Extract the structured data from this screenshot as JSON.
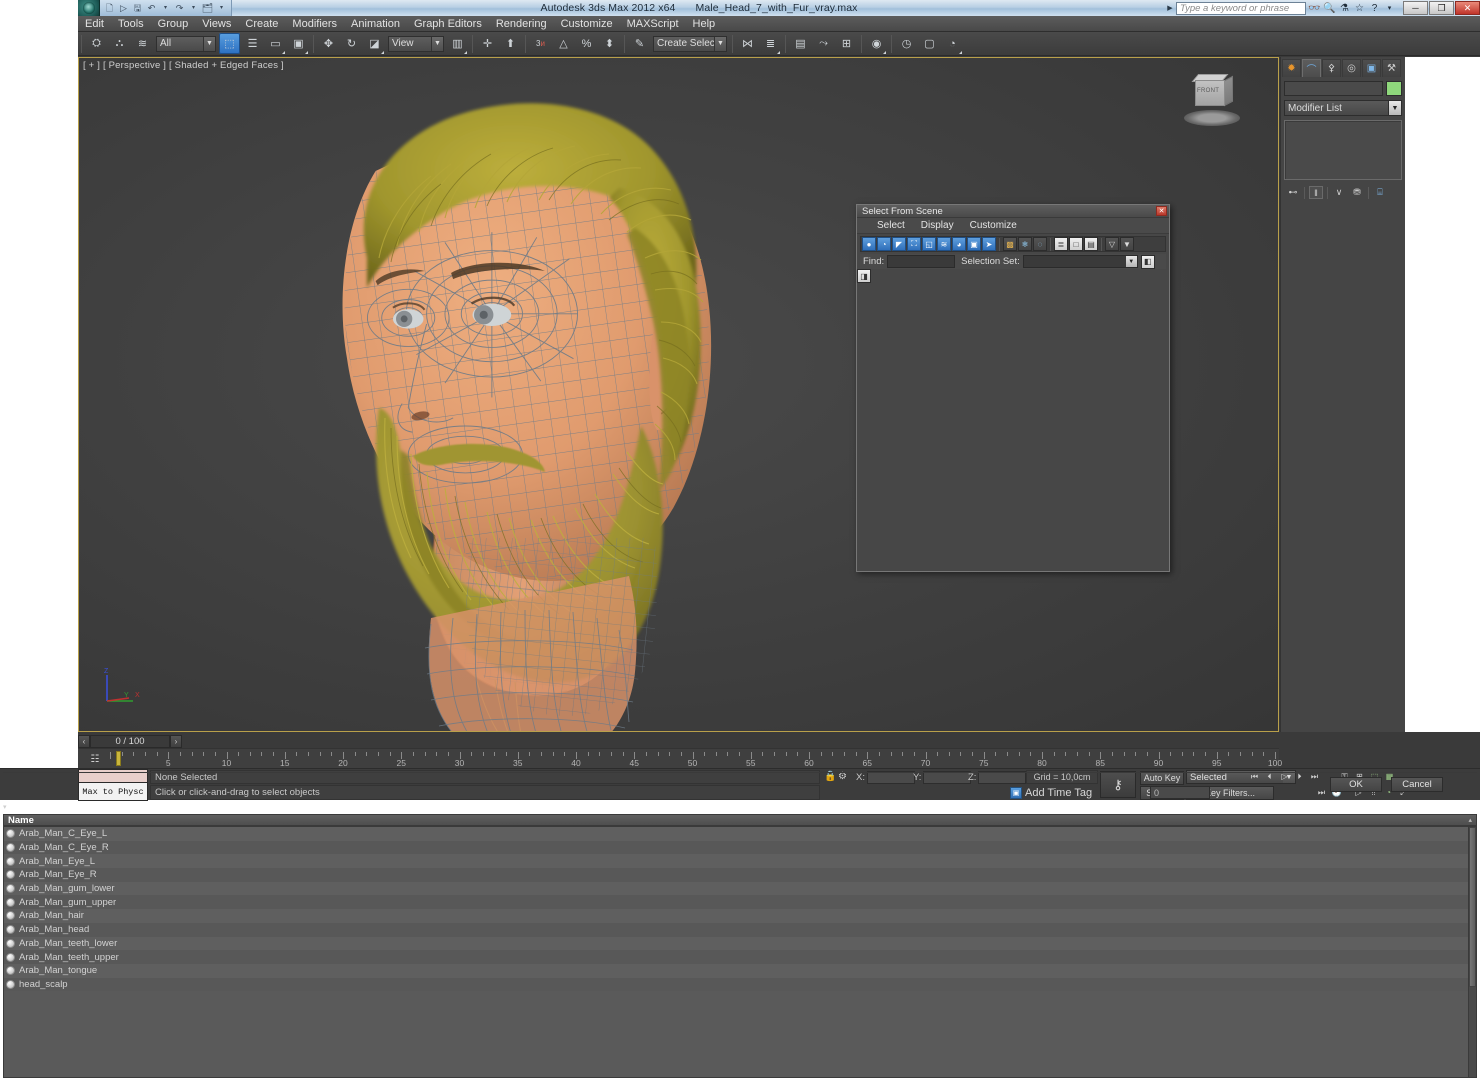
{
  "window": {
    "app_title": "Autodesk 3ds Max  2012 x64",
    "file_title": "Male_Head_7_with_Fur_vray.max",
    "search_placeholder": "Type a keyword or phrase",
    "minimize": "─",
    "maximize": "❐",
    "close": "✕",
    "quick_access": [
      {
        "name": "new-icon",
        "glyph": "὜B"
      },
      {
        "name": "open-icon",
        "glyph": "▷"
      },
      {
        "name": "save-icon",
        "glyph": "ὋE"
      },
      {
        "name": "undo-icon",
        "glyph": "↶"
      },
      {
        "name": "undo-dropdown-icon",
        "glyph": "▾"
      },
      {
        "name": "redo-icon",
        "glyph": "↷"
      },
      {
        "name": "redo-dropdown-icon",
        "glyph": "▾"
      },
      {
        "name": "set-project-folder-icon",
        "glyph": "὜2"
      },
      {
        "name": "qat-dropdown-icon",
        "glyph": "▾"
      }
    ],
    "title_icons": [
      {
        "name": "search-binoculars-icon",
        "glyph": "ඞ"
      },
      {
        "name": "magnifier-icon",
        "glyph": "ὐD"
      },
      {
        "name": "subscription-icon",
        "glyph": "⚗"
      },
      {
        "name": "favorites-star-icon",
        "glyph": "☆"
      },
      {
        "name": "help-icon",
        "glyph": "?"
      },
      {
        "name": "help-dropdown-icon",
        "glyph": "·"
      }
    ]
  },
  "menubar": {
    "items": [
      "Edit",
      "Tools",
      "Group",
      "Views",
      "Create",
      "Modifiers",
      "Animation",
      "Graph Editors",
      "Rendering",
      "Customize",
      "MAXScript",
      "Help"
    ]
  },
  "toolbar": {
    "selection_filter": "All",
    "reference_coord": "View",
    "named_selection_set": "Create Selection Se",
    "buttons": [
      {
        "name": "select-and-link-button",
        "glyph": "⚭",
        "on": false
      },
      {
        "name": "unlink-selection-button",
        "glyph": "⚮",
        "on": false
      },
      {
        "name": "bind-to-space-warp-button",
        "glyph": "≈",
        "on": false
      },
      {
        "name": "select-object-button",
        "glyph": "⬚",
        "on": true
      },
      {
        "name": "select-by-name-button",
        "glyph": "☰",
        "on": false
      },
      {
        "name": "rectangular-selection-region-button",
        "glyph": "▭",
        "on": false
      },
      {
        "name": "window-crossing-button",
        "glyph": "▣",
        "on": false
      },
      {
        "name": "select-and-move-button",
        "glyph": "✥",
        "on": false
      },
      {
        "name": "select-and-rotate-button",
        "glyph": "↻",
        "on": false
      },
      {
        "name": "select-and-scale-button",
        "glyph": "◢",
        "on": false
      },
      {
        "name": "use-center-flyout-button",
        "glyph": "▤",
        "on": false
      },
      {
        "name": "select-and-manipulate-button",
        "glyph": "✣",
        "on": false
      },
      {
        "name": "keyboard-shortcut-override-button",
        "glyph": "▲",
        "on": false
      },
      {
        "name": "snaps-toggle-button",
        "glyph": "3",
        "on": false
      },
      {
        "name": "angle-snap-toggle-button",
        "glyph": "△",
        "on": false
      },
      {
        "name": "percent-snap-toggle-button",
        "glyph": "%",
        "on": false
      },
      {
        "name": "spinner-snap-toggle-button",
        "glyph": "⬍",
        "on": false
      },
      {
        "name": "edit-named-selection-sets-button",
        "glyph": "✎",
        "on": false
      },
      {
        "name": "mirror-button",
        "glyph": "⦀",
        "on": false
      },
      {
        "name": "align-button",
        "glyph": "≡",
        "on": false
      },
      {
        "name": "layer-manager-button",
        "glyph": "☷",
        "on": false
      },
      {
        "name": "graph-editors-button",
        "glyph": "⤳",
        "on": false
      },
      {
        "name": "schematic-view-button",
        "glyph": "⊞",
        "on": false
      },
      {
        "name": "material-editor-button",
        "glyph": "◉",
        "on": false
      },
      {
        "name": "render-setup-button",
        "glyph": "◴",
        "on": false
      },
      {
        "name": "rendered-frame-window-button",
        "glyph": "□",
        "on": false
      },
      {
        "name": "render-production-button",
        "glyph": "◔",
        "on": false
      }
    ]
  },
  "viewport": {
    "label": "[ + ] [ Perspective ] [ Shaded + Edged Faces ]",
    "viewcube_face": "FRONT",
    "axis_labels": [
      "Z",
      "Y",
      "X"
    ],
    "colors": {
      "background": "#434343",
      "skin": "#e09b6e",
      "skin_shadow": "#b87a55",
      "hair": "#a49a2f",
      "hair_dark": "#7e7420",
      "wireframe": "#6d7b88",
      "eye": "#8a8f93"
    }
  },
  "timeline": {
    "frame_display": "0 / 100",
    "prev_glyph": "‹",
    "next_glyph": "›",
    "range_start": 0,
    "range_end": 100,
    "tick_labels": [
      "5",
      "10",
      "15",
      "20",
      "25",
      "30",
      "35",
      "40",
      "45",
      "50",
      "55",
      "60",
      "65",
      "70",
      "75",
      "80",
      "85",
      "90",
      "95",
      "100"
    ],
    "current_frame": 0,
    "open_mini_curve_editor_icon": "☷"
  },
  "status": {
    "max_to_physx_label": "Max to Physc",
    "selection_status": "None Selected",
    "prompt": "Click or click-and-drag to select objects",
    "lock_icon": "ὑ2",
    "transform_icon": "⚙",
    "coords": [
      {
        "label": "X:",
        "value": ""
      },
      {
        "label": "Y:",
        "value": ""
      },
      {
        "label": "Z:",
        "value": ""
      }
    ],
    "grid": "Grid = 10,0cm",
    "add_time_tag": "Add Time Tag",
    "key_mode_icon": "⚷",
    "auto_key": "Auto Key",
    "set_key": "Set Key",
    "key_filters": "Key Filters...",
    "selected_dropdown": "Selected",
    "spinner_value": "0",
    "playback": [
      {
        "name": "go-to-start-button",
        "glyph": "⏮"
      },
      {
        "name": "previous-frame-button",
        "glyph": "⏴"
      },
      {
        "name": "play-animation-button",
        "glyph": "▷"
      },
      {
        "name": "next-frame-button",
        "glyph": "⏵"
      },
      {
        "name": "go-to-end-button",
        "glyph": "⏭"
      }
    ],
    "viewport_nav": [
      {
        "name": "zoom-button",
        "glyph": "ὐD"
      },
      {
        "name": "zoom-all-button",
        "glyph": "⊞"
      },
      {
        "name": "zoom-extents-button",
        "glyph": "⬚"
      },
      {
        "name": "zoom-extents-all-button",
        "glyph": "▦"
      },
      {
        "name": "field-of-view-button",
        "glyph": "◑"
      },
      {
        "name": "pan-view-button",
        "glyph": "✋"
      },
      {
        "name": "orbit-button",
        "glyph": "◌"
      },
      {
        "name": "maximize-viewport-toggle-button",
        "glyph": "⤢"
      }
    ]
  },
  "command_panel": {
    "tabs": [
      {
        "name": "create-tab",
        "glyph": "☀",
        "active": false
      },
      {
        "name": "modify-tab",
        "glyph": "⌒",
        "active": true
      },
      {
        "name": "hierarchy-tab",
        "glyph": "⑂",
        "active": false
      },
      {
        "name": "motion-tab",
        "glyph": "◎",
        "active": false
      },
      {
        "name": "display-tab",
        "glyph": "▣",
        "active": false
      },
      {
        "name": "utilities-tab",
        "glyph": "⚒",
        "active": false
      }
    ],
    "object_name": "",
    "object_color": "#8fd87c",
    "modifier_list": "Modifier List",
    "stack_buttons": [
      {
        "name": "pin-stack-button",
        "glyph": "⊸"
      },
      {
        "name": "show-end-result-button",
        "glyph": "║"
      },
      {
        "name": "make-unique-button",
        "glyph": "∨"
      },
      {
        "name": "remove-modifier-button",
        "glyph": "⛃"
      },
      {
        "name": "configure-modifier-sets-button",
        "glyph": "⌸"
      }
    ]
  },
  "dialog": {
    "title": "Select From Scene",
    "close_glyph": "✕",
    "menu": [
      "Select",
      "Display",
      "Customize"
    ],
    "toolbar": [
      {
        "name": "display-geometry-icon",
        "glyph": "●",
        "on": true
      },
      {
        "name": "display-shapes-icon",
        "glyph": "◔",
        "on": true
      },
      {
        "name": "display-lights-icon",
        "glyph": "◤",
        "on": true
      },
      {
        "name": "display-cameras-icon",
        "glyph": "὏7",
        "on": true
      },
      {
        "name": "display-helpers-icon",
        "glyph": "◱",
        "on": true
      },
      {
        "name": "display-space-warps-icon",
        "glyph": "≋",
        "on": true
      },
      {
        "name": "display-groups-icon",
        "glyph": "◕",
        "on": true
      },
      {
        "name": "display-xrefs-icon",
        "glyph": "▣",
        "on": true
      },
      {
        "name": "display-bones-icon",
        "glyph": "➤",
        "on": true
      },
      {
        "name": "display-containers-icon",
        "glyph": "὎6",
        "on": false
      },
      {
        "name": "display-frozen-icon",
        "glyph": "❄",
        "on": false
      },
      {
        "name": "display-hidden-icon",
        "glyph": "○",
        "on": false
      },
      {
        "name": "expand-all-icon",
        "glyph": "≣",
        "light": true
      },
      {
        "name": "collapse-all-icon",
        "glyph": "□",
        "light": true
      },
      {
        "name": "expand-selected-icon",
        "glyph": "▤",
        "light": true
      },
      {
        "name": "filter-icon",
        "glyph": "▽",
        "on": false
      },
      {
        "name": "clear-filter-icon",
        "glyph": "▼",
        "on": false
      }
    ],
    "find_label": "Find:",
    "find_value": "",
    "selection_set_label": "Selection Set:",
    "selection_set_value": "",
    "set_buttons": [
      {
        "name": "add-selection-set-icon",
        "glyph": "◧"
      },
      {
        "name": "remove-selection-set-icon",
        "glyph": "◨"
      },
      {
        "name": "edit-selection-set-icon",
        "glyph": "▥"
      },
      {
        "name": "more-options-icon",
        "glyph": "▾"
      }
    ],
    "column_header": "Name",
    "sort_glyph": "▴",
    "items": [
      "Arab_Man_C_Eye_L",
      "Arab_Man_C_Eye_R",
      "Arab_Man_Eye_L",
      "Arab_Man_Eye_R",
      "Arab_Man_gum_lower",
      "Arab_Man_gum_upper",
      "Arab_Man_hair",
      "Arab_Man_head",
      "Arab_Man_teeth_lower",
      "Arab_Man_teeth_upper",
      "Arab_Man_tongue",
      "head_scalp"
    ],
    "ok_label": "OK",
    "cancel_label": "Cancel"
  }
}
